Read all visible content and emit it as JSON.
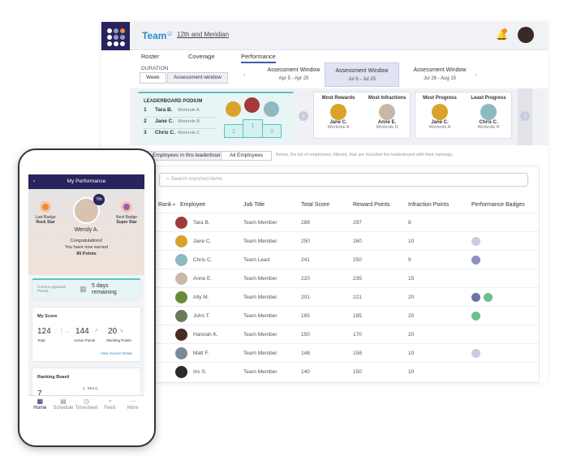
{
  "header": {
    "team": "Team",
    "location": "12th and Meridian",
    "notification_count": "2"
  },
  "tabs": [
    "Roster",
    "Coverage",
    "Performance"
  ],
  "duration": {
    "label": "DURATION",
    "options": [
      "Week",
      "Assessment window"
    ],
    "selected": "Assessment window"
  },
  "windows": [
    {
      "title": "Assessment Window",
      "range": "Apr 5 - Apr 25"
    },
    {
      "title": "Assessment Window",
      "range": "Jul 6 - Jul 25",
      "selected": true
    },
    {
      "title": "Assessment Window",
      "range": "Jul 26 - Aug 15"
    }
  ],
  "podium": {
    "title": "LEADERBOARD PODIUM",
    "rows": [
      {
        "rank": "1",
        "name": "Tara B.",
        "role": "Workrole A"
      },
      {
        "rank": "2",
        "name": "Jane C.",
        "role": "Workrole B"
      },
      {
        "rank": "3",
        "name": "Chris C.",
        "role": "Workrole C"
      }
    ],
    "blocks": [
      "2",
      "1",
      "3"
    ]
  },
  "highlights": [
    {
      "title": "Most Rewards",
      "name": "Jane C.",
      "role": "Workrole A",
      "color": "#d9a22a"
    },
    {
      "title": "Most Infractions",
      "name": "Anne E.",
      "role": "Workrole D",
      "color": "#c9b8a8"
    },
    {
      "title": "Most Progress",
      "name": "Jane C.",
      "role": "Workrole A",
      "color": "#d9a22a"
    },
    {
      "title": "Least Progress",
      "name": "Chris C.",
      "role": "Workrole B",
      "color": "#8fb9bf"
    }
  ],
  "filters": {
    "options": [
      "Employees in this leaderboard",
      "All Employees"
    ],
    "note": "Below, the list of employees, filtered, that are included the leaderboard with their rankings."
  },
  "table": {
    "search_placeholder": "Search reported items",
    "columns": [
      "Rank",
      "Employee",
      "Job Title",
      "Total Score",
      "Reward Points",
      "Infraction Points",
      "Performance Badges"
    ],
    "rows": [
      {
        "name": "Tara B.",
        "title": "Team Member",
        "total": "289",
        "reward": "297",
        "infraction": "8",
        "badges": [],
        "color": "#a23a3a"
      },
      {
        "name": "Jane C.",
        "title": "Team Member",
        "total": "250",
        "reward": "260",
        "infraction": "10",
        "badges": [
          "#c7cce0"
        ],
        "color": "#d9a22a"
      },
      {
        "name": "Chris C.",
        "title": "Team Lead",
        "total": "241",
        "reward": "250",
        "infraction": "9",
        "badges": [
          "#8e90c0"
        ],
        "color": "#8fb9bf"
      },
      {
        "name": "Anne E.",
        "title": "Team Member",
        "total": "220",
        "reward": "235",
        "infraction": "15",
        "badges": [],
        "color": "#c9b8a8"
      },
      {
        "name": "Ally M.",
        "title": "Team Member",
        "total": "201",
        "reward": "221",
        "infraction": "20",
        "badges": [
          "#6e72a8",
          "#6cc08a"
        ],
        "color": "#6a8a3a"
      },
      {
        "name": "John T.",
        "title": "Team Member",
        "total": "165",
        "reward": "185",
        "infraction": "20",
        "badges": [
          "#6cc08a"
        ],
        "color": "#6a7a5a"
      },
      {
        "name": "Hannah K.",
        "title": "Team Member",
        "total": "150",
        "reward": "170",
        "infraction": "20",
        "badges": [],
        "color": "#4a2a22"
      },
      {
        "name": "Matt F.",
        "title": "Team Member",
        "total": "148",
        "reward": "158",
        "infraction": "10",
        "badges": [
          "#c7cce0"
        ],
        "color": "#7a8a9a"
      },
      {
        "name": "Iris S.",
        "title": "Team Member",
        "total": "140",
        "reward": "150",
        "infraction": "10",
        "badges": [],
        "color": "#2a2a2a"
      }
    ]
  },
  "phone": {
    "title": "My Performance",
    "rank": "7th",
    "name": "Wendy A.",
    "last_badge_label": "Last Badge",
    "last_badge": "Rock Star",
    "next_badge_label": "Next Badge",
    "next_badge": "Super Star",
    "congrats": "Congratulations!",
    "earned": "You have now earned",
    "points": "85 Points",
    "appraisal_label": "Current Appraisal Period:",
    "days": "5 days",
    "remaining": "remaining",
    "score": {
      "title": "My Score",
      "total": "124",
      "total_label": "Total",
      "action": "144",
      "action_label": "Action Points",
      "slacking": "20",
      "slacking_label": "Slacking Points",
      "link": "View Scores' Detail"
    },
    "ranking": {
      "title": "Ranking Board",
      "value": "7",
      "first": "1   Kim C."
    },
    "nav": [
      "Home",
      "Schedule",
      "Timesheet",
      "Feed",
      "More"
    ]
  }
}
